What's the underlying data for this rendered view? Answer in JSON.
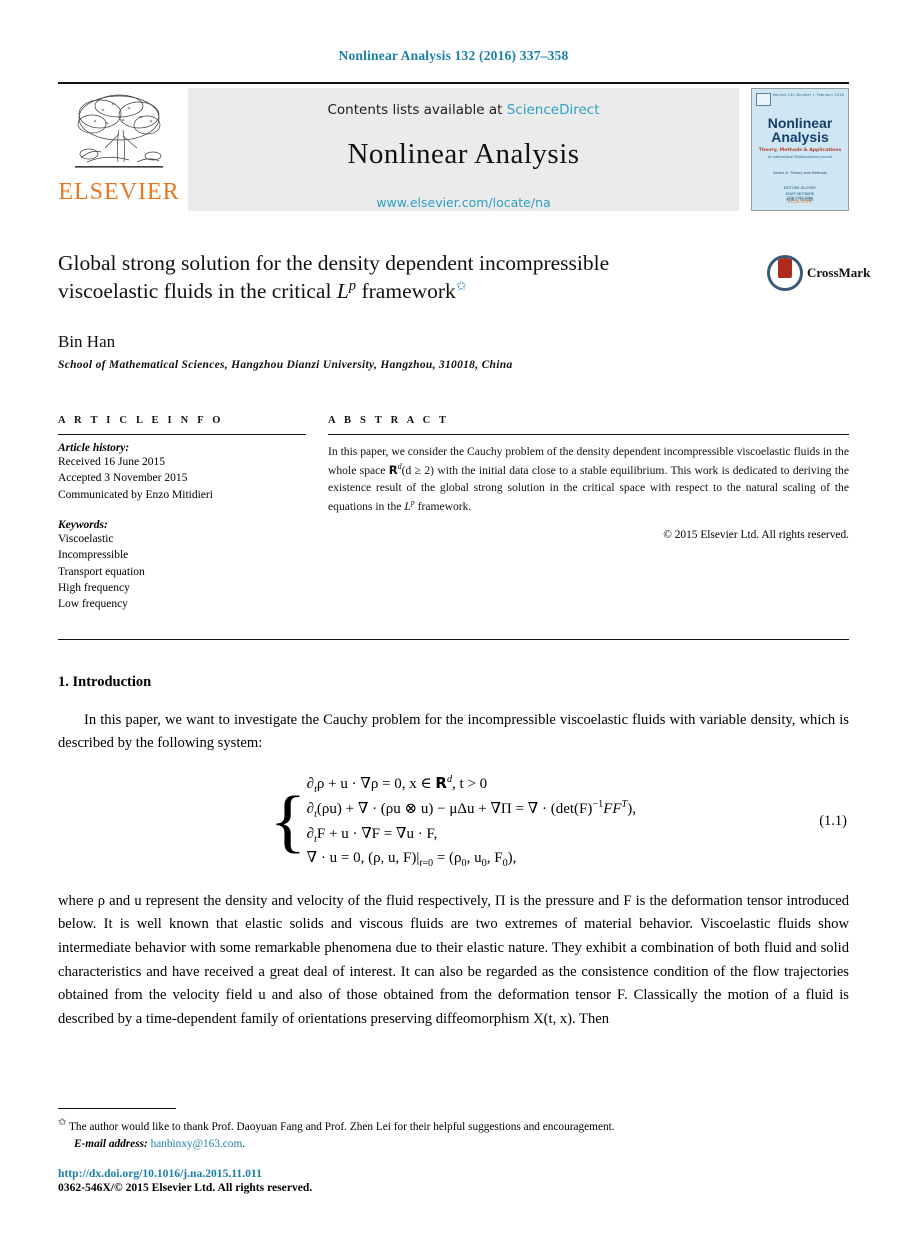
{
  "running_head": "Nonlinear Analysis 132 (2016) 337–358",
  "masthead": {
    "publisher_name": "ELSEVIER",
    "contents_prefix": "Contents lists available at",
    "contents_link": "ScienceDirect",
    "journal_title": "Nonlinear Analysis",
    "journal_url": "www.elsevier.com/locate/na",
    "cover": {
      "title_line1": "Nonlinear",
      "title_line2": "Analysis",
      "subtitle": "Theory, Methods & Applications",
      "subtitle2": "An International Multidisciplinary Journal",
      "volume_label": "Volume 132",
      "number_label": "Number 1",
      "date_label": "February 2016",
      "series_note": "Series A: Theory and Methods",
      "editors": [
        "EDITORS-IN-CHIEF",
        "ENZO MITIDIERI",
        "RON C. ROSIER"
      ],
      "publisher": "ELSEVIER",
      "issn_note": "ISSN 0362-546X"
    }
  },
  "article": {
    "title_part1": "Global strong solution for the density dependent incompressible",
    "title_part2": "viscoelastic fluids in the critical ",
    "title_math": "L",
    "title_math_sup": "p",
    "title_part3": " framework",
    "title_footnote_marker": "✩",
    "crossmark_label": "CrossMark",
    "author": "Bin Han",
    "affiliation": "School of Mathematical Sciences, Hangzhou Dianzi University, Hangzhou, 310018, China"
  },
  "info": {
    "section_label": "A R T I C L E   I N F O",
    "history_title": "Article history:",
    "history": [
      "Received 16 June 2015",
      "Accepted 3 November 2015",
      "Communicated by Enzo Mitidieri"
    ],
    "keywords_title": "Keywords:",
    "keywords": [
      "Viscoelastic",
      "Incompressible",
      "Transport equation",
      "High frequency",
      "Low frequency"
    ]
  },
  "abstract": {
    "section_label": "A B S T R A C T",
    "text_before_math": "In this paper, we consider the Cauchy problem of the density dependent incompressible viscoelastic fluids in the whole space ",
    "math_space": "R",
    "math_space_sup": "d",
    "math_cond": "(d ≥ 2)",
    "text_mid": " with the initial data close to a stable equilibrium. This work is dedicated to deriving the existence result of the global strong solution in the critical space with respect to the natural scaling of the equations in the ",
    "math_lp": "L",
    "math_lp_sup": "p",
    "text_end": " framework.",
    "copyright": "© 2015 Elsevier Ltd. All rights reserved."
  },
  "body": {
    "section_number_title": "1. Introduction",
    "paragraph1": "In this paper, we want to investigate the Cauchy problem for the incompressible viscoelastic fluids with variable density, which is described by the following system:",
    "equation": {
      "number": "(1.1)",
      "line1_a": "∂",
      "line1": "ρ + u · ∇ρ = 0,    x ∈ ",
      "line1_b": ", t > 0",
      "line2": "(ρu) + ∇ · (ρu ⊗ u) − μΔu + ∇Π = ∇ · (det(F)",
      "line3": "F + u · ∇F = ∇u · F,",
      "line4": "∇ · u = 0,        (ρ, u, F)|",
      "line4_b": " = (ρ",
      "line4_c": ", u",
      "line4_d": ", F",
      "line4_e": "),"
    },
    "paragraph2_part1": "where ρ and u represent the density and velocity of the fluid respectively, Π is the pressure and F is the deformation tensor introduced below. It is well known that elastic solids and viscous fluids are two extremes of material behavior. Viscoelastic fluids show intermediate behavior with some remarkable phenomena due to their elastic nature. They exhibit a combination of both fluid and solid characteristics and have received a great deal of interest. It can also be regarded as the consistence condition of the flow trajectories obtained from the velocity field u and also of those obtained from the deformation tensor F. Classically the motion of a fluid is described by a time-dependent family of orientations preserving diffeomorphism X(t, x). Then"
  },
  "footnotes": {
    "star_marker": "✩",
    "acknowledgment": "The author would like to thank Prof. Daoyuan Fang and Prof. Zhen Lei for their helpful suggestions and encouragement.",
    "email_label": "E-mail address:",
    "email": "hanbinxy@163.com",
    "email_period": ".",
    "doi": "http://dx.doi.org/10.1016/j.na.2015.11.011",
    "issn_line": "0362-546X/© 2015 Elsevier Ltd. All rights reserved."
  },
  "colors": {
    "link_blue": "#1a7fa8",
    "sciencedirect_blue": "#2e9fc4",
    "elsevier_orange": "#e87722",
    "cover_blue": "#cfe7f5",
    "crossmark_red": "#b02a1c"
  }
}
